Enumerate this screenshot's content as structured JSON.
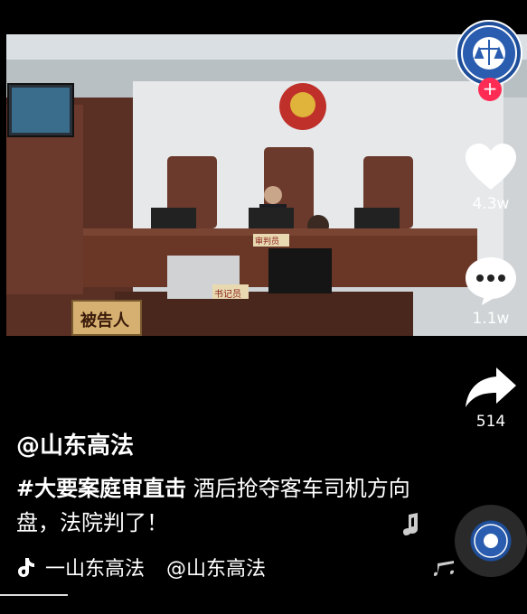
{
  "video": {
    "banner_defendant": "被告人",
    "clerk_sign": "书记员",
    "judge_sign": "审判员"
  },
  "actions": {
    "like_count": "4.3w",
    "comment_count": "1.1w",
    "share_count": "514"
  },
  "post": {
    "author": "@山东高法",
    "hashtag": "#大要案庭审直击",
    "description": "酒后抢夺客车司机方向盘，法院判了！"
  },
  "music": {
    "label": "一山东高法",
    "author": "@山东高法"
  },
  "colors": {
    "accent": "#fe2c55",
    "brand": "#1f4e9a"
  },
  "icons": [
    "heart-icon",
    "comment-icon",
    "share-icon",
    "tiktok-note-icon",
    "music-note-icon"
  ]
}
